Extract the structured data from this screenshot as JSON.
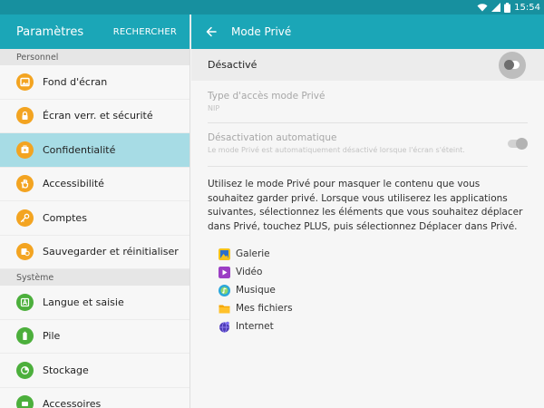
{
  "status_bar": {
    "time": "15:54"
  },
  "left": {
    "title": "Paramètres",
    "search_label": "RECHERCHER",
    "sections": [
      {
        "header": "Personnel",
        "items": [
          {
            "label": "Fond d'écran",
            "icon": "wallpaper-icon",
            "selected": false
          },
          {
            "label": "Écran verr. et sécurité",
            "icon": "lock-icon",
            "selected": false
          },
          {
            "label": "Confidentialité",
            "icon": "privacy-icon",
            "selected": true
          },
          {
            "label": "Accessibilité",
            "icon": "hand-icon",
            "selected": false
          },
          {
            "label": "Comptes",
            "icon": "key-icon",
            "selected": false
          },
          {
            "label": "Sauvegarder et réinitialiser",
            "icon": "backup-icon",
            "selected": false
          }
        ]
      },
      {
        "header": "Système",
        "items": [
          {
            "label": "Langue et saisie",
            "icon": "language-icon",
            "selected": false
          },
          {
            "label": "Pile",
            "icon": "battery-icon",
            "selected": false
          },
          {
            "label": "Stockage",
            "icon": "storage-icon",
            "selected": false
          },
          {
            "label": "Accessoires",
            "icon": "accessories-icon",
            "selected": false
          }
        ]
      }
    ]
  },
  "right": {
    "title": "Mode Privé",
    "master": {
      "label": "Désactivé",
      "on": false
    },
    "access_type": {
      "title": "Type d'accès mode Privé",
      "value": "NIP"
    },
    "auto_disable": {
      "title": "Désactivation automatique",
      "subtitle": "Le mode Privé est automatiquement désactivé lorsque l'écran s'éteint."
    },
    "description": "Utilisez le mode Privé pour masquer le contenu que vous souhaitez garder privé. Lorsque vous utiliserez les applications suivantes, sélectionnez les éléments que vous souhaitez déplacer dans Privé, touchez PLUS, puis sélectionnez Déplacer dans Privé.",
    "apps": [
      {
        "label": "Galerie",
        "icon": "gallery-icon"
      },
      {
        "label": "Vidéo",
        "icon": "video-icon"
      },
      {
        "label": "Musique",
        "icon": "music-icon"
      },
      {
        "label": "Mes fichiers",
        "icon": "folder-icon"
      },
      {
        "label": "Internet",
        "icon": "internet-icon"
      }
    ]
  },
  "colors": {
    "header": "#1ba6b7",
    "status_bar": "#17909f",
    "selected_item": "#a7dce5",
    "personal_icon": "#f3a421",
    "system_icon": "#4caf3c"
  }
}
